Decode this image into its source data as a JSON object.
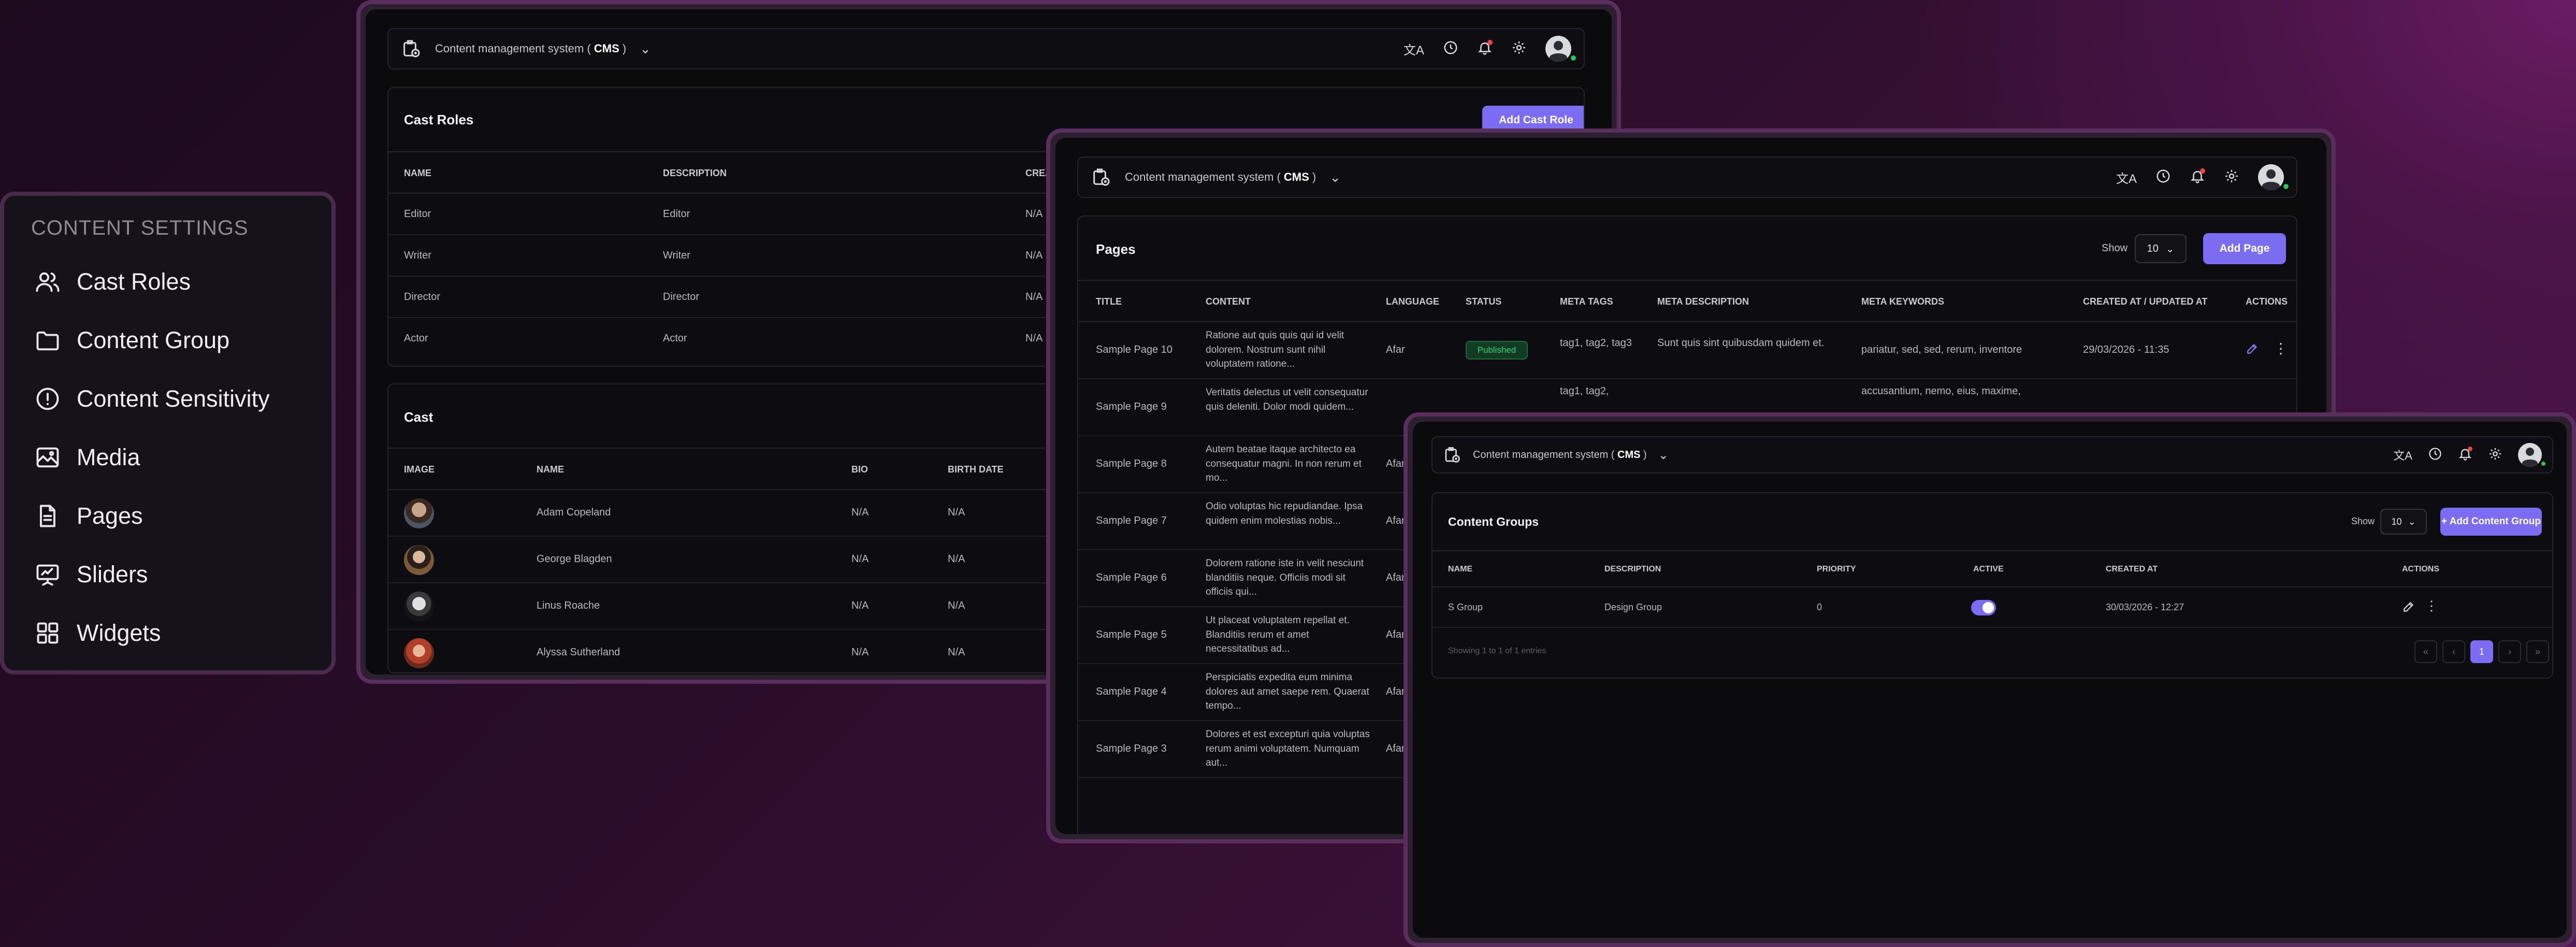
{
  "app_title_prefix": "Content management system ( ",
  "app_title_bold": "CMS",
  "app_title_suffix": " )",
  "sidebar": {
    "heading": "CONTENT SETTINGS",
    "items": [
      {
        "label": "Cast Roles",
        "icon": "users-icon"
      },
      {
        "label": "Content Group",
        "icon": "folder-icon"
      },
      {
        "label": "Content Sensitivity",
        "icon": "alert-circle-icon"
      },
      {
        "label": "Media",
        "icon": "image-icon"
      },
      {
        "label": "Pages",
        "icon": "file-icon"
      },
      {
        "label": "Sliders",
        "icon": "presentation-icon"
      },
      {
        "label": "Widgets",
        "icon": "grid-icon"
      }
    ]
  },
  "cast_roles": {
    "title": "Cast Roles",
    "add_button": "Add Cast Role",
    "columns": [
      "NAME",
      "DESCRIPTION",
      "CREATED"
    ],
    "rows": [
      [
        "Editor",
        "Editor",
        "N/A"
      ],
      [
        "Writer",
        "Writer",
        "N/A"
      ],
      [
        "Director",
        "Director",
        "N/A"
      ],
      [
        "Actor",
        "Actor",
        "N/A"
      ]
    ]
  },
  "cast": {
    "title": "Cast",
    "columns": [
      "IMAGE",
      "NAME",
      "BIO",
      "BIRTH DATE"
    ],
    "rows": [
      [
        "Adam Copeland",
        "N/A",
        "N/A"
      ],
      [
        "George Blagden",
        "N/A",
        "N/A"
      ],
      [
        "Linus Roache",
        "N/A",
        "N/A"
      ],
      [
        "Alyssa Sutherland",
        "N/A",
        "N/A"
      ]
    ]
  },
  "pages": {
    "title": "Pages",
    "show_label": "Show",
    "show_value": "10",
    "add_button": "Add Page",
    "columns": [
      "TITLE",
      "CONTENT",
      "LANGUAGE",
      "STATUS",
      "META TAGS",
      "META DESCRIPTION",
      "META KEYWORDS",
      "CREATED AT / UPDATED AT",
      "ACTIONS"
    ],
    "rows": [
      {
        "title": "Sample Page 10",
        "content": "Ratione aut quis quis qui id velit dolorem. Nostrum sunt nihil voluptatem ratione...",
        "language": "Afar",
        "status": "Published",
        "tags": "tag1, tag2, tag3",
        "desc": "Sunt quis sint quibusdam quidem et.",
        "keywords": "pariatur, sed, sed, rerum, inventore",
        "created": "29/03/2026 - 11:35"
      },
      {
        "title": "Sample Page 9",
        "content": "Veritatis delectus ut velit consequatur quis deleniti. Dolor modi quidem...",
        "language": "",
        "status": "",
        "tags": "tag1, tag2,",
        "desc": "",
        "keywords": "accusantium, nemo, eius, maxime,",
        "created": ""
      },
      {
        "title": "Sample Page 8",
        "content": "Autem beatae itaque architecto ea consequatur magni. In non rerum et mo...",
        "language": "Afar"
      },
      {
        "title": "Sample Page 7",
        "content": "Odio voluptas hic repudiandae. Ipsa quidem enim molestias nobis...",
        "language": "Afar"
      },
      {
        "title": "Sample Page 6",
        "content": "Dolorem ratione iste in velit nesciunt blanditiis neque. Officiis modi sit officiis qui...",
        "language": "Afar"
      },
      {
        "title": "Sample Page 5",
        "content": "Ut placeat voluptatem repellat et. Blanditiis rerum et amet necessitatibus ad...",
        "language": "Afar"
      },
      {
        "title": "Sample Page 4",
        "content": "Perspiciatis expedita eum minima dolores aut amet saepe rem. Quaerat tempo...",
        "language": "Afar"
      },
      {
        "title": "Sample Page 3",
        "content": "Dolores et est excepturi quia voluptas rerum animi voluptatem. Numquam aut...",
        "language": "Afar"
      }
    ]
  },
  "content_groups": {
    "title": "Content Groups",
    "show_label": "Show",
    "show_value": "10",
    "add_button": "+ Add Content Group",
    "columns": [
      "NAME",
      "DESCRIPTION",
      "PRIORITY",
      "ACTIVE",
      "CREATED AT",
      "ACTIONS"
    ],
    "rows": [
      {
        "name": "S Group",
        "description": "Design Group",
        "priority": "0",
        "active": true,
        "created": "30/03/2026 - 12:27"
      }
    ],
    "footer": "Showing 1 to 1 of 1 entries",
    "pagination": [
      "«",
      "‹",
      "1",
      "›",
      "»"
    ]
  },
  "colors": {
    "accent": "#7b6cf2",
    "published": "#33d17a",
    "online": "#22c55e"
  }
}
